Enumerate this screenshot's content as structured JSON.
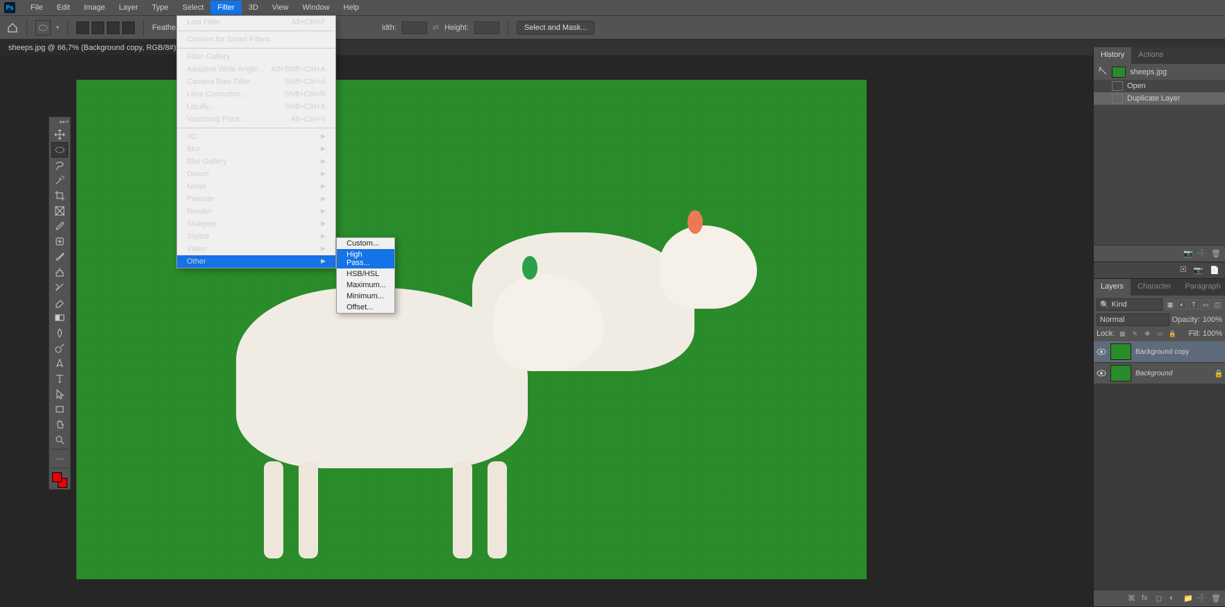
{
  "menubar": {
    "items": [
      "File",
      "Edit",
      "Image",
      "Layer",
      "Type",
      "Select",
      "Filter",
      "3D",
      "View",
      "Window",
      "Help"
    ],
    "active_index": 6
  },
  "optbar": {
    "feather_label": "Feather:",
    "width_label": "idth:",
    "height_label": "Height:",
    "select_mask": "Select and Mask..."
  },
  "doctab": {
    "title": "sheeps.jpg @ 66,7% (Background copy, RGB/8#) *"
  },
  "filter_menu": {
    "items": [
      {
        "label": "Last Filter",
        "shortcut": "Alt+Ctrl+F",
        "gray": true
      },
      {
        "sep": true
      },
      {
        "label": "Convert for Smart Filters"
      },
      {
        "sep": true
      },
      {
        "label": "Filter Gallery..."
      },
      {
        "label": "Adaptive Wide Angle...",
        "shortcut": "Alt+Shift+Ctrl+A"
      },
      {
        "label": "Camera Raw Filter...",
        "shortcut": "Shift+Ctrl+A"
      },
      {
        "label": "Lens Correction...",
        "shortcut": "Shift+Ctrl+R"
      },
      {
        "label": "Liquify...",
        "shortcut": "Shift+Ctrl+X"
      },
      {
        "label": "Vanishing Point...",
        "shortcut": "Alt+Ctrl+V"
      },
      {
        "sep": true
      },
      {
        "label": "3D",
        "sub": true
      },
      {
        "label": "Blur",
        "sub": true
      },
      {
        "label": "Blur Gallery",
        "sub": true
      },
      {
        "label": "Distort",
        "sub": true
      },
      {
        "label": "Noise",
        "sub": true
      },
      {
        "label": "Pixelate",
        "sub": true
      },
      {
        "label": "Render",
        "sub": true
      },
      {
        "label": "Sharpen",
        "sub": true
      },
      {
        "label": "Stylize",
        "sub": true
      },
      {
        "label": "Video",
        "sub": true
      },
      {
        "label": "Other",
        "sub": true,
        "highlighted": true
      }
    ]
  },
  "other_submenu": {
    "items": [
      {
        "label": "Custom..."
      },
      {
        "label": "High Pass...",
        "highlighted": true
      },
      {
        "label": "HSB/HSL"
      },
      {
        "label": "Maximum..."
      },
      {
        "label": "Minimum..."
      },
      {
        "label": "Offset..."
      }
    ]
  },
  "history_panel": {
    "tabs": [
      "History",
      "Actions"
    ],
    "active_tab": 0,
    "source": "sheeps.jpg",
    "steps": [
      "Open",
      "Duplicate Layer"
    ],
    "selected_step": 1
  },
  "layers_panel": {
    "tabs": [
      "Layers",
      "Character",
      "Paragraph"
    ],
    "active_tab": 0,
    "kind_label": "Kind",
    "blend_mode": "Normal",
    "opacity_label": "Opacity:",
    "opacity_value": "100%",
    "lock_label": "Lock:",
    "fill_label": "Fill:",
    "fill_value": "100%",
    "search_icon": "🔍",
    "layers": [
      {
        "name": "Background copy",
        "selected": true,
        "locked": false
      },
      {
        "name": "Background",
        "selected": false,
        "locked": true,
        "italic": true
      }
    ]
  },
  "tools": {
    "items": [
      "move",
      "marquee",
      "lasso",
      "wand",
      "crop",
      "frame",
      "eyedropper",
      "healing",
      "brush",
      "clone",
      "history-brush",
      "eraser",
      "gradient",
      "blur",
      "dodge",
      "pen",
      "type",
      "path-select",
      "rectangle",
      "hand",
      "zoom"
    ],
    "active_index": 1
  }
}
